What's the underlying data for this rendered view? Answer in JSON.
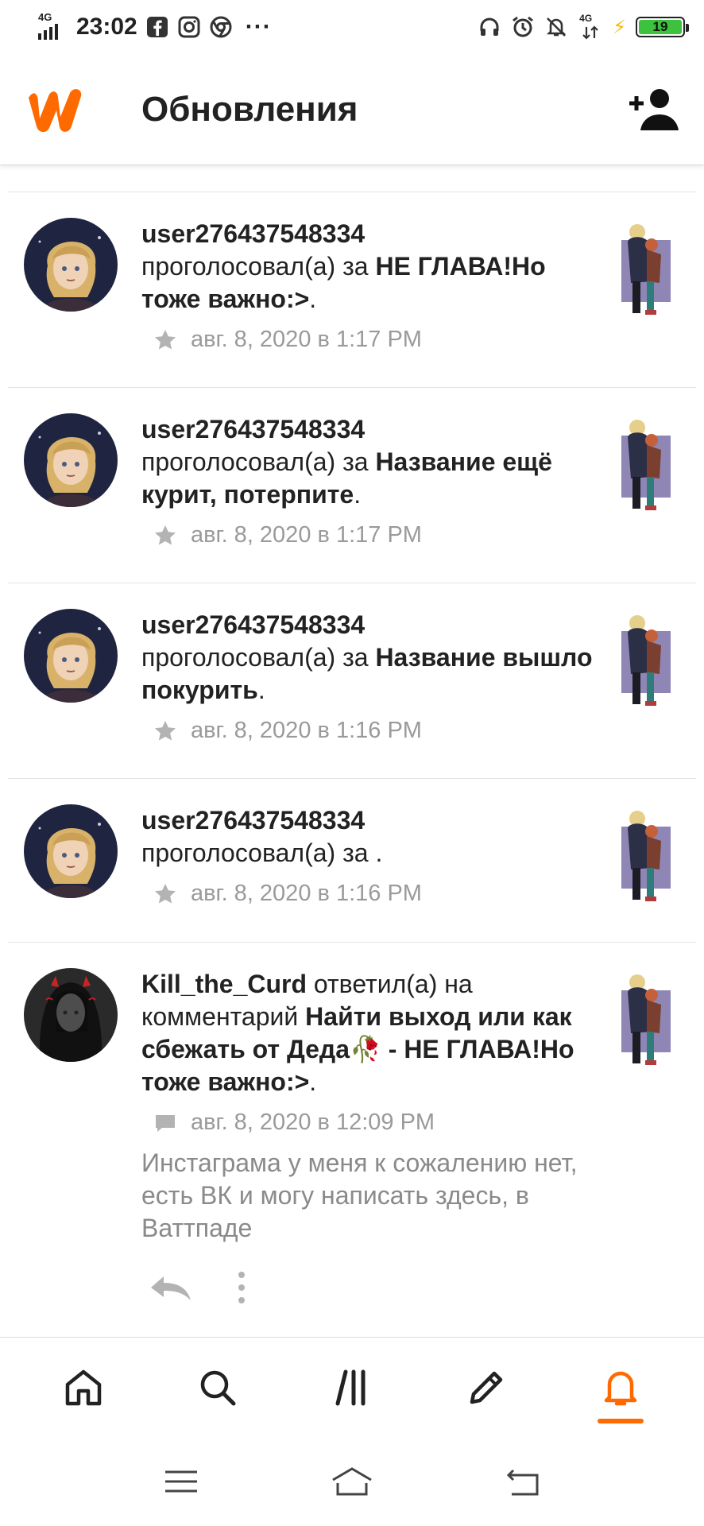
{
  "status_bar": {
    "network_left": "4G",
    "time": "23:02",
    "network_right": "4G",
    "battery": "19"
  },
  "header": {
    "title": "Обновления"
  },
  "notifications": [
    {
      "username": "user276437548334",
      "action": "проголосовал(а) за",
      "story": "НЕ ГЛАВА!Но тоже важно:>",
      "suffix": ".",
      "timestamp": "авг. 8, 2020 в 1:17 PM",
      "meta_icon": "star-icon"
    },
    {
      "username": "user276437548334",
      "action": "проголосовал(а) за",
      "story": "Название ещё курит, потерпите",
      "suffix": ".",
      "timestamp": "авг. 8, 2020 в 1:17 PM",
      "meta_icon": "star-icon"
    },
    {
      "username": "user276437548334",
      "action": "проголосовал(а) за",
      "story": "Название вышло покурить",
      "suffix": ".",
      "timestamp": "авг. 8, 2020 в 1:16 PM",
      "meta_icon": "star-icon"
    },
    {
      "username": "user276437548334",
      "action": "проголосовал(а) за",
      "story": "",
      "suffix": ".",
      "timestamp": "авг. 8, 2020 в 1:16 PM",
      "meta_icon": "star-icon"
    }
  ],
  "comment_notification": {
    "username": "Kill_the_Curd",
    "action": "ответил(а) на комментарий",
    "story": "Найти выход или как сбежать от Деда🥀 - НЕ ГЛАВА!Но тоже важно:>",
    "suffix": ".",
    "timestamp": "авг. 8, 2020 в 12:09 PM",
    "meta_icon": "comment-icon",
    "comment": "Инстаграма у меня к сожалению нет, есть ВК и могу написать здесь, в Ваттпаде"
  },
  "bottom_nav": {
    "items": [
      "home-icon",
      "search-icon",
      "library-icon",
      "write-icon",
      "notifications-bell-icon"
    ],
    "active": "notifications-bell-icon"
  },
  "colors": {
    "brand": "#ff6a00",
    "meta_gray": "#9a9a9a",
    "text": "#222222"
  }
}
